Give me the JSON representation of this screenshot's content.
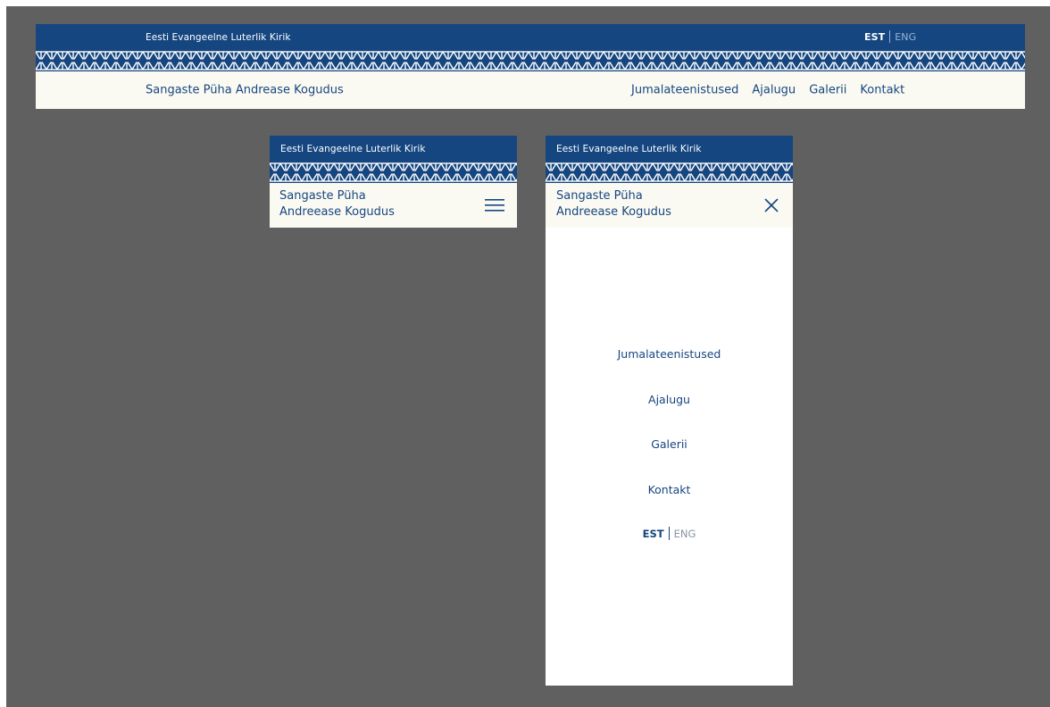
{
  "header": {
    "org_name": "Eesti Evangeelne Luterlik Kirik",
    "site_title": "Sangaste Püha Andrease Kogudus",
    "site_title_line1": "Sangaste Püha",
    "site_title_line2": "Andreease Kogudus"
  },
  "language": {
    "est": "EST",
    "eng": "ENG",
    "active": "EST"
  },
  "nav": {
    "items": [
      {
        "label": "Jumalateenistused"
      },
      {
        "label": "Ajalugu"
      },
      {
        "label": "Galerii"
      },
      {
        "label": "Kontakt"
      }
    ]
  },
  "icons": {
    "menu": "hamburger-menu-icon",
    "close": "close-icon"
  },
  "colors": {
    "primary": "#154680",
    "nav_background": "#fbfaf2",
    "canvas": "#606060",
    "menu_background": "#ffffff"
  }
}
